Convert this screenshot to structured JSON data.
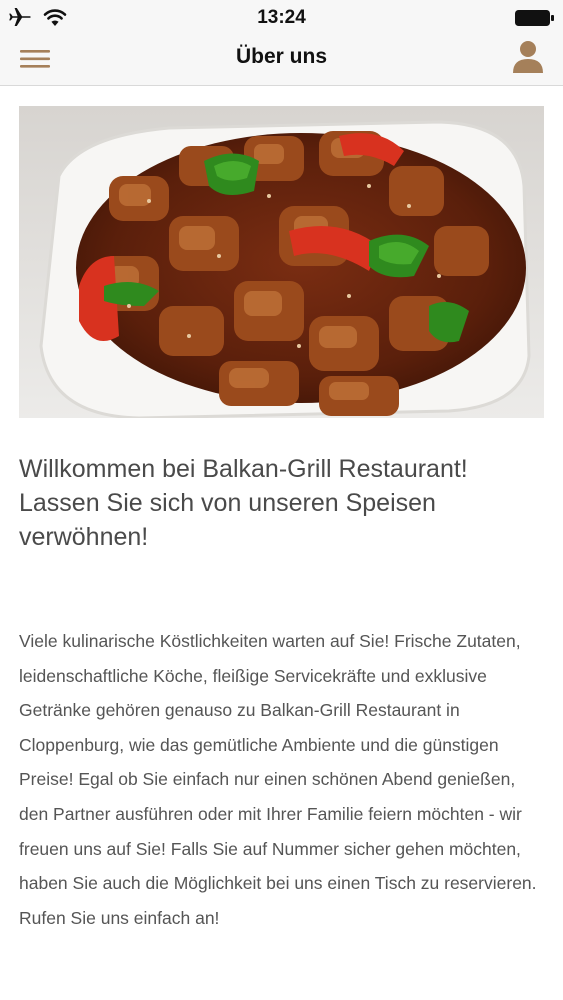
{
  "status_bar": {
    "time": "13:24",
    "icons": [
      "airplane-icon",
      "wifi-icon",
      "battery-icon"
    ]
  },
  "nav": {
    "title": "Über uns",
    "left_icon": "menu-icon",
    "right_icon": "user-icon",
    "accent_color": "#a5805a"
  },
  "hero": {
    "subject": "restaurant-dish-photo"
  },
  "content": {
    "headline": "Willkommen bei Balkan-Grill Restaurant! Lassen Sie sich von unseren Speisen verwöhnen!",
    "body": "Viele kulinarische Köstlichkeiten warten auf Sie! Frische Zutaten, leidenschaftliche Köche, fleißige Servicekräfte und exklusive Getränke gehören genauso zu Balkan-Grill Restaurant in Cloppenburg, wie das gemütliche Ambiente und die günstigen Preise! Egal ob Sie einfach nur einen schönen Abend genießen, den Partner ausführen oder mit Ihrer Familie feiern möchten - wir freuen uns auf Sie! Falls Sie auf Nummer sicher gehen möchten, haben Sie auch die Möglichkeit bei uns einen Tisch zu reservieren. Rufen Sie uns einfach an!"
  }
}
